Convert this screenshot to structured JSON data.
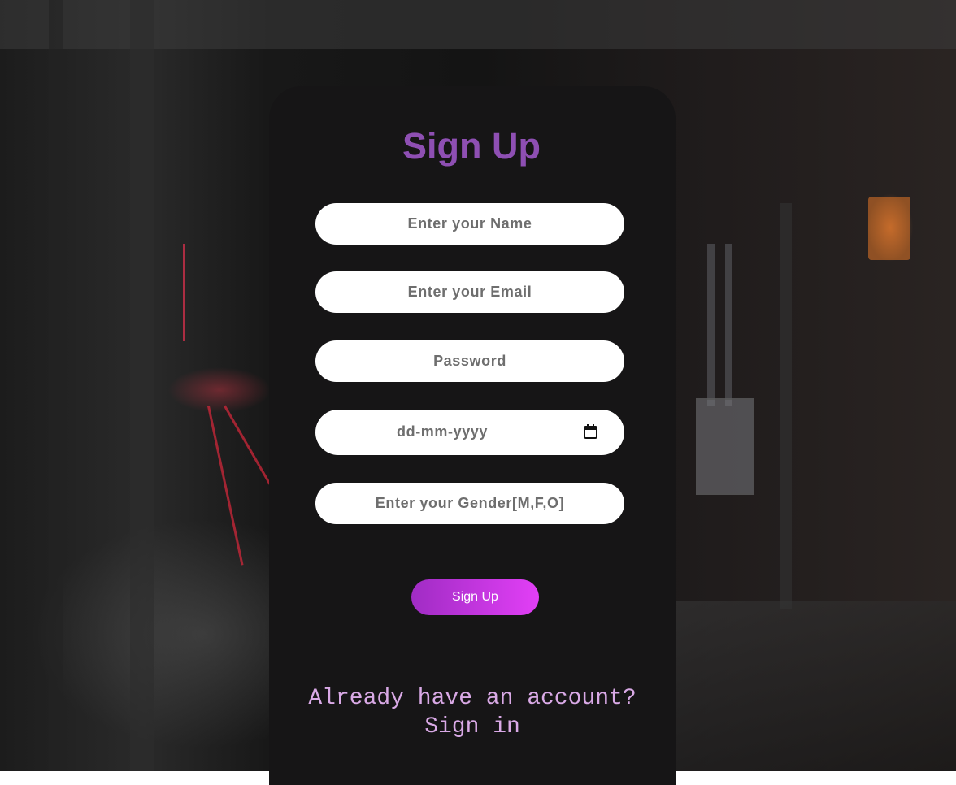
{
  "page": {
    "title": "Sign Up"
  },
  "form": {
    "name_placeholder": "Enter your Name",
    "email_placeholder": "Enter your Email",
    "password_placeholder": "Password",
    "date_placeholder": "dd-mm-yyyy",
    "gender_placeholder": "Enter your Gender[M,F,O]",
    "submit_label": "Sign Up"
  },
  "footer": {
    "question": "Already have an account?",
    "link_label": "Sign in"
  },
  "icons": {
    "date_picker": "calendar-icon"
  },
  "colors": {
    "title": "#8e4fb3",
    "card": "#161516",
    "button_start": "#a02cc4",
    "button_end": "#e23ff6",
    "footer_text": "#d9a9e6"
  }
}
